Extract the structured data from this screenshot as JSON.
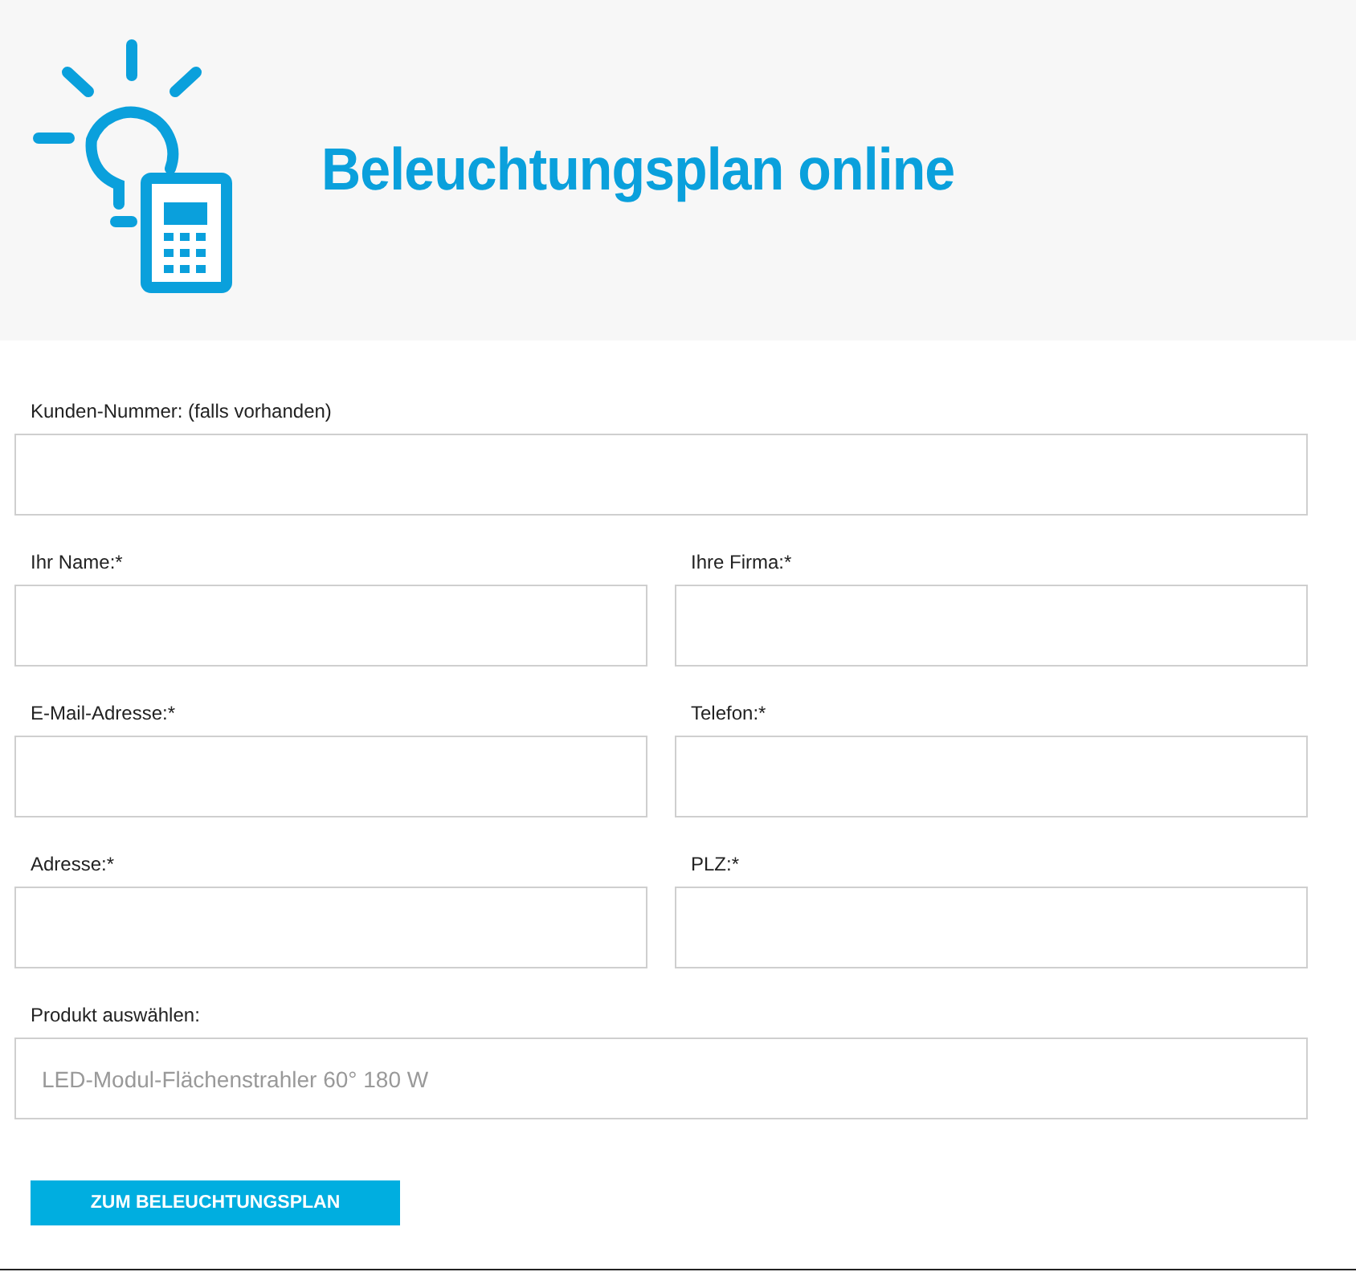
{
  "header": {
    "title": "Beleuchtungsplan online"
  },
  "rows": [
    {
      "fields": [
        {
          "label": "Kunden-Nummer: (falls vorhanden)"
        }
      ]
    },
    {
      "fields": [
        {
          "label": "Ihr Name:*"
        },
        {
          "label": "Ihre Firma:*"
        }
      ]
    },
    {
      "fields": [
        {
          "label": "E-Mail-Adresse:*"
        },
        {
          "label": "Telefon:*"
        }
      ]
    },
    {
      "fields": [
        {
          "label": "Adresse:*"
        },
        {
          "label": "PLZ:*"
        }
      ]
    },
    {
      "fields": [
        {
          "label": "Produkt auswählen:",
          "value": "LED-Modul-Flächenstrahler 60° 180 W"
        }
      ]
    }
  ],
  "submit": "ZUM BELEUCHTUNGSPLAN"
}
